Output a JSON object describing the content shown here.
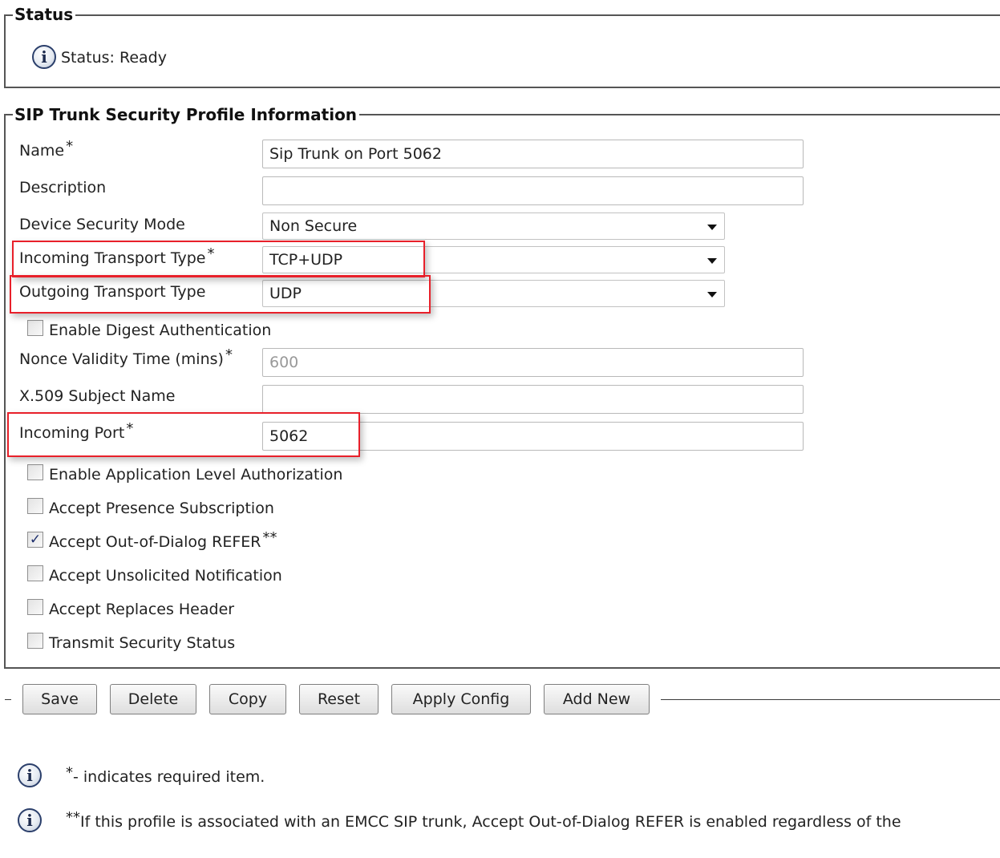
{
  "status": {
    "legend": "Status",
    "message": "Status: Ready",
    "icon": "info-icon"
  },
  "profile": {
    "legend": "SIP Trunk Security Profile Information",
    "name_label": "Name",
    "name_value": "Sip Trunk on Port 5062",
    "description_label": "Description",
    "description_value": "",
    "device_security_mode_label": "Device Security Mode",
    "device_security_mode_value": "Non Secure",
    "incoming_transport_label": "Incoming Transport Type",
    "incoming_transport_value": "TCP+UDP",
    "outgoing_transport_label": "Outgoing Transport Type",
    "outgoing_transport_value": "UDP",
    "digest_auth_label": "Enable Digest Authentication",
    "digest_auth_checked": false,
    "nonce_label": "Nonce Validity Time (mins)",
    "nonce_value": "600",
    "x509_label": "X.509 Subject Name",
    "x509_value": "",
    "incoming_port_label": "Incoming Port",
    "incoming_port_value": "5062",
    "required_marker": "*",
    "double_marker": "**",
    "checkboxes": [
      {
        "label": "Enable Application Level Authorization",
        "checked": false
      },
      {
        "label": "Accept Presence Subscription",
        "checked": false
      },
      {
        "label": "Accept Out-of-Dialog REFER",
        "checked": true
      },
      {
        "label": "Accept Unsolicited Notification",
        "checked": false
      },
      {
        "label": "Accept Replaces Header",
        "checked": false
      },
      {
        "label": "Transmit Security Status",
        "checked": false
      }
    ]
  },
  "buttons": {
    "save": "Save",
    "delete": "Delete",
    "copy": "Copy",
    "reset": "Reset",
    "apply_config": "Apply Config",
    "add_new": "Add New"
  },
  "notes": {
    "required_star": "*",
    "required": "- indicates required item.",
    "emcc_stars": "**",
    "emcc": "If this profile is associated with an EMCC SIP trunk, Accept Out-of-Dialog REFER is enabled regardless of the"
  },
  "colors": {
    "highlight": "#e8202a",
    "icon_border": "#2b3f6b"
  }
}
